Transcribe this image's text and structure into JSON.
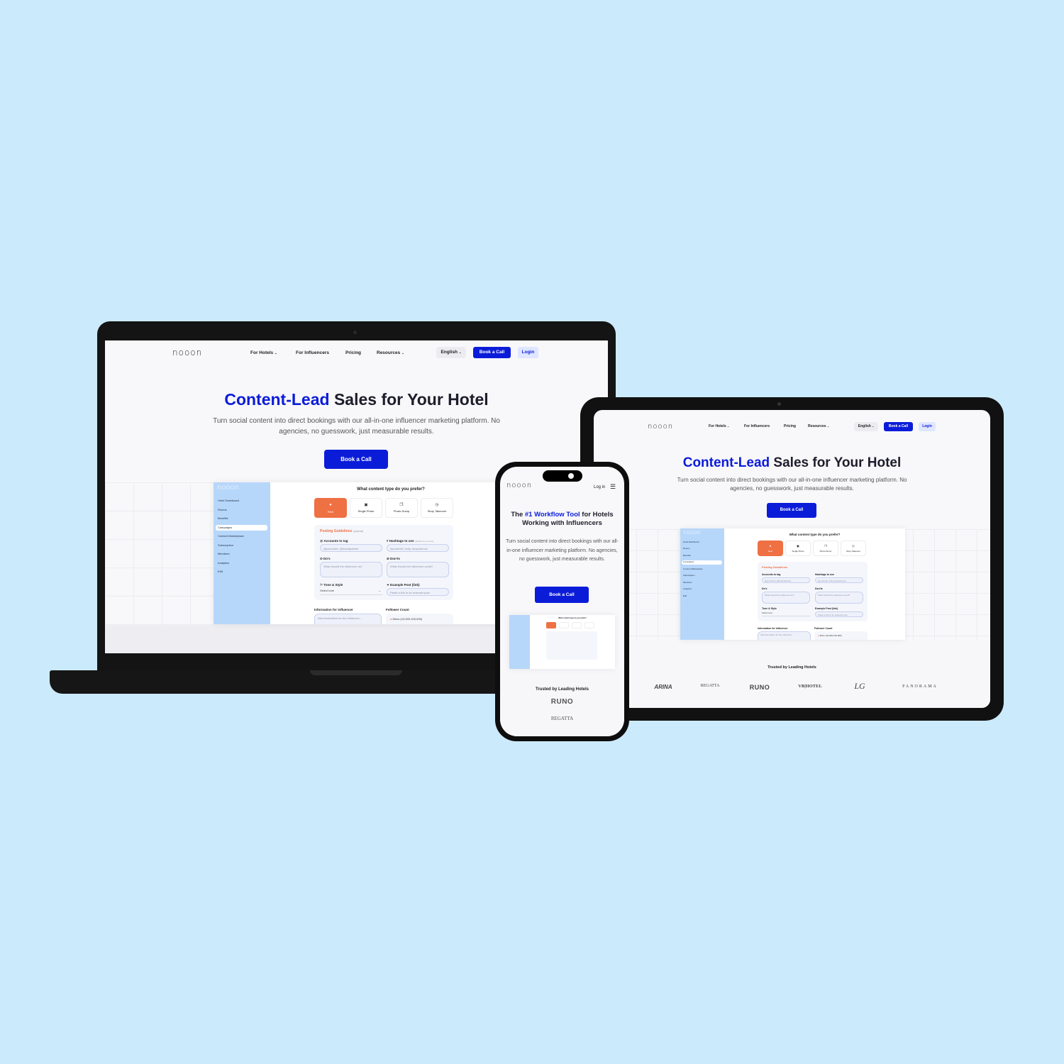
{
  "site": {
    "logo": "nooon",
    "nav": {
      "for_hotels": "For Hotels",
      "for_influencers": "For Influencers",
      "pricing": "Pricing",
      "resources": "Resources",
      "language": "English",
      "book_call": "Book a Call",
      "login": "Login"
    },
    "hero": {
      "title_accent": "Content-Lead",
      "title_rest": " Sales for Your Hotel",
      "subtitle_line1": "Turn social content into direct bookings with our all-in-one influencer marketing platform. No",
      "subtitle_line2": "agencies, no guesswork, just measurable results.",
      "cta": "Book a Call"
    },
    "mobile_hero": {
      "title_prefix": "The ",
      "title_accent": "#1 Workflow Tool",
      "title_suffix": " for Hotels",
      "title_line2": "Working with Influencers",
      "subtitle": "Turn social content into direct bookings with our all-in-one influencer marketing platform. No agencies, no guesswork, just measurable results.",
      "cta": "Book a Call",
      "login": "Log in"
    },
    "dashboard": {
      "sidebar": [
        "Hotel Dashboard",
        "Rooms",
        "Benefits",
        "Campaigns",
        "Content Marketplace",
        "Subscription",
        "Members",
        "Analytics",
        "Edit"
      ],
      "active_index": 3,
      "content_question": "What content type do you prefer?",
      "content_types": [
        "Reel",
        "Single Photo",
        "Photo Dump",
        "Story Takeover"
      ],
      "guidelines_title": "Posting Guidelines",
      "guidelines_optional": "(optional)",
      "accounts_label": "Accounts to tag",
      "accounts_placeholder": "@yourhotel, @brandpartner",
      "hashtags_label": "Hashtags to use",
      "hashtags_note": "(divided by comma)",
      "hashtags_placeholder": "#yourhotel, #city, #experience",
      "dos_label": "Do's",
      "dos_placeholder": "What should the influencer do?",
      "donts_label": "Don'ts",
      "donts_placeholder": "What should the influencer avoid?",
      "tone_label": "Tone & Style",
      "tone_value": "Select tone",
      "example_label": "Example Post (link)",
      "example_placeholder": "Paste a link to an example post",
      "info_label": "Information for Influencer",
      "info_placeholder": "Add information for the influencer...",
      "followers_label": "Follower Count",
      "followers_value": "Micro (10,000-100,000)"
    },
    "trusted": {
      "title": "Trusted by Leading Hotels",
      "brands": [
        "ARINA",
        "REGATTA",
        "RUNO",
        "VB|HOTEL",
        "LG",
        "PANORAMA"
      ]
    }
  },
  "colors": {
    "background": "#cbeafc",
    "brand_blue": "#0b1cd9",
    "accent_orange": "#ef7043",
    "sidebar_blue": "#b7d7fa"
  }
}
